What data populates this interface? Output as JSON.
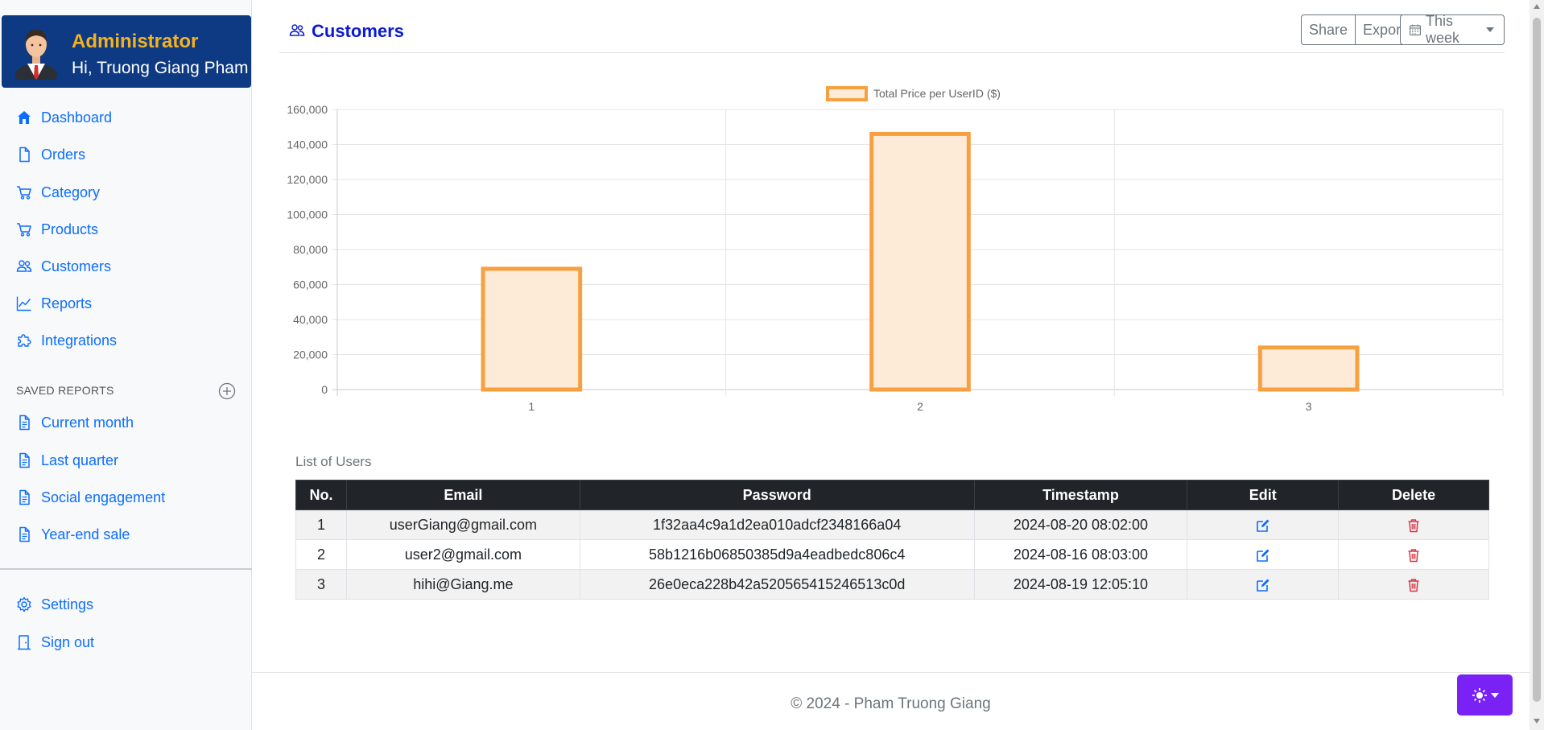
{
  "profile": {
    "role": "Administrator",
    "greeting": "Hi, Truong Giang Pham"
  },
  "sidebar": {
    "nav": [
      {
        "label": "Dashboard",
        "icon": "house-icon"
      },
      {
        "label": "Orders",
        "icon": "file-icon"
      },
      {
        "label": "Category",
        "icon": "cart-icon"
      },
      {
        "label": "Products",
        "icon": "cart-icon"
      },
      {
        "label": "Customers",
        "icon": "people-icon"
      },
      {
        "label": "Reports",
        "icon": "graph-icon"
      },
      {
        "label": "Integrations",
        "icon": "puzzle-icon"
      }
    ],
    "saved_title": "SAVED REPORTS",
    "saved": [
      {
        "label": "Current month",
        "icon": "file-text-icon"
      },
      {
        "label": "Last quarter",
        "icon": "file-text-icon"
      },
      {
        "label": "Social engagement",
        "icon": "file-text-icon"
      },
      {
        "label": "Year-end sale",
        "icon": "file-text-icon"
      }
    ],
    "bottom": [
      {
        "label": "Settings",
        "icon": "gear-icon"
      },
      {
        "label": "Sign out",
        "icon": "door-icon"
      }
    ]
  },
  "header": {
    "title": "Customers",
    "share_label": "Share",
    "export_label": "Export",
    "period_label": "This week"
  },
  "chart_data": {
    "type": "bar",
    "legend": "Total Price per UserID ($)",
    "categories": [
      "1",
      "2",
      "3"
    ],
    "values": [
      69000,
      146000,
      24000
    ],
    "ylim": [
      0,
      160000
    ],
    "yticks": [
      "0",
      "20,000",
      "40,000",
      "60,000",
      "80,000",
      "100,000",
      "120,000",
      "140,000",
      "160,000"
    ],
    "grid": true,
    "legend_position": "top",
    "bar_fill": "#fdebd7",
    "bar_stroke": "#f7a042"
  },
  "table": {
    "caption": "List of Users",
    "headers": [
      "No.",
      "Email",
      "Password",
      "Timestamp",
      "Edit",
      "Delete"
    ],
    "rows": [
      {
        "no": "1",
        "email": "userGiang@gmail.com",
        "password": "1f32aa4c9a1d2ea010adcf2348166a04",
        "timestamp": "2024-08-20 08:02:00"
      },
      {
        "no": "2",
        "email": "user2@gmail.com",
        "password": "58b1216b06850385d9a4eadbedc806c4",
        "timestamp": "2024-08-16 08:03:00"
      },
      {
        "no": "3",
        "email": "hihi@Giang.me",
        "password": "26e0eca228b42a520565415246513c0d",
        "timestamp": "2024-08-19 12:05:10"
      }
    ]
  },
  "footer": {
    "text": "© 2024 - Pham Truong Giang"
  },
  "colors": {
    "accent": "#0d6efd",
    "profile_bg": "#0d3a82",
    "profile_role": "#f5b21f",
    "theme_button": "#7a22f5",
    "delete": "#dc3545"
  }
}
